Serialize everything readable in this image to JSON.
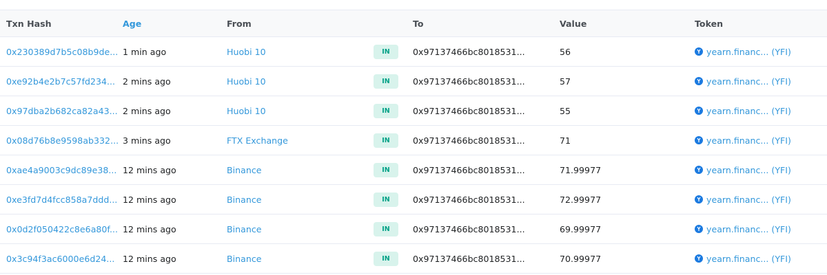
{
  "columns": {
    "hash": "Txn Hash",
    "age": "Age",
    "from": "From",
    "to": "To",
    "value": "Value",
    "token": "Token"
  },
  "colors": {
    "link": "#3498db",
    "badge_bg": "#d8f3ec",
    "badge_text": "#00a186",
    "token_icon": "#1b7ae0"
  },
  "rows": [
    {
      "hash": "0x230389d7b5c08b9de...",
      "age": "1 min ago",
      "from": "Huobi 10",
      "dir": "IN",
      "to": "0x97137466bc8018531...",
      "value": "56",
      "token": "yearn.financ... (YFI)",
      "icon": "yfi-token-icon"
    },
    {
      "hash": "0xe92b4e2b7c57fd234...",
      "age": "2 mins ago",
      "from": "Huobi 10",
      "dir": "IN",
      "to": "0x97137466bc8018531...",
      "value": "57",
      "token": "yearn.financ... (YFI)",
      "icon": "yfi-token-icon"
    },
    {
      "hash": "0x97dba2b682ca82a43...",
      "age": "2 mins ago",
      "from": "Huobi 10",
      "dir": "IN",
      "to": "0x97137466bc8018531...",
      "value": "55",
      "token": "yearn.financ... (YFI)",
      "icon": "yfi-token-icon"
    },
    {
      "hash": "0x08d76b8e9598ab332...",
      "age": "3 mins ago",
      "from": "FTX Exchange",
      "dir": "IN",
      "to": "0x97137466bc8018531...",
      "value": "71",
      "token": "yearn.financ... (YFI)",
      "icon": "yfi-token-icon"
    },
    {
      "hash": "0xae4a9003c9dc89e38...",
      "age": "12 mins ago",
      "from": "Binance",
      "dir": "IN",
      "to": "0x97137466bc8018531...",
      "value": "71.99977",
      "token": "yearn.financ... (YFI)",
      "icon": "yfi-token-icon"
    },
    {
      "hash": "0xe3fd7d4fcc858a7ddd...",
      "age": "12 mins ago",
      "from": "Binance",
      "dir": "IN",
      "to": "0x97137466bc8018531...",
      "value": "72.99977",
      "token": "yearn.financ... (YFI)",
      "icon": "yfi-token-icon"
    },
    {
      "hash": "0x0d2f050422c8e6a80f...",
      "age": "12 mins ago",
      "from": "Binance",
      "dir": "IN",
      "to": "0x97137466bc8018531...",
      "value": "69.99977",
      "token": "yearn.financ... (YFI)",
      "icon": "yfi-token-icon"
    },
    {
      "hash": "0x3c94f3ac6000e6d24...",
      "age": "12 mins ago",
      "from": "Binance",
      "dir": "IN",
      "to": "0x97137466bc8018531...",
      "value": "70.99977",
      "token": "yearn.financ... (YFI)",
      "icon": "yfi-token-icon"
    }
  ]
}
